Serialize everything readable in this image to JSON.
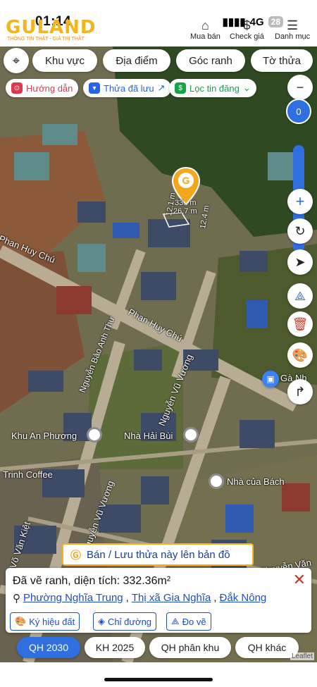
{
  "status": {
    "time": "01:14",
    "network": "4G",
    "battery": "28"
  },
  "header": {
    "logo": "GULAND",
    "tagline": "THÔNG TIN THẬT - GIÁ TRỊ THẬT",
    "nav": [
      {
        "label": "Mua bán",
        "icon": "house-icon"
      },
      {
        "label": "Check giá",
        "icon": "dollar-icon"
      },
      {
        "label": "Danh mục",
        "icon": "menu-icon"
      }
    ]
  },
  "filters": [
    "Khu vực",
    "Địa điểm",
    "Góc ranh",
    "Tờ thửa"
  ],
  "chips": [
    {
      "label": "Hướng dẫn",
      "color": "#e0374f"
    },
    {
      "label": "Thửa đã lưu",
      "color": "#2563eb"
    },
    {
      "label": "Lọc tin đăng",
      "color": "#16a34a"
    }
  ],
  "slider": {
    "value": "0"
  },
  "parcel": {
    "side1": "12.1 m",
    "side2": "26.7 m",
    "side3": "12.4 m",
    "area_short": "33.. m"
  },
  "map_labels": [
    "Phan Huy Chú",
    "Phan Huy Chú",
    "Nguyễn Bảo Anh Thư",
    "Nguyễn Vũ Vương",
    "Nguyễn Vũ Vương",
    "Khu An Phương",
    "Nhà Hải Bùi",
    "Trinh Coffee",
    "Nhà của Bách",
    "Võ Văn Kiệt",
    "Gà Nh",
    "Nguyễn Văn Kiệt"
  ],
  "cta_label": "Bán / Lưu thửa này lên bản đồ",
  "card": {
    "title": "Đã vẽ ranh, diện tích: 332.36m²",
    "ward": "Phường Nghĩa Trung",
    "town": "Thị xã Gia Nghĩa",
    "province": "Đắk Nông",
    "buttons": [
      "Ký hiệu đất",
      "Chỉ đường",
      "Đo vẽ"
    ]
  },
  "qh_tabs": [
    "QH 2030",
    "KH 2025",
    "QH phân khu",
    "QH khác"
  ],
  "attribution": "Leaflet",
  "colors": {
    "accent": "#2f6fe0",
    "brand": "#f2b51d",
    "danger": "#e0374f"
  }
}
